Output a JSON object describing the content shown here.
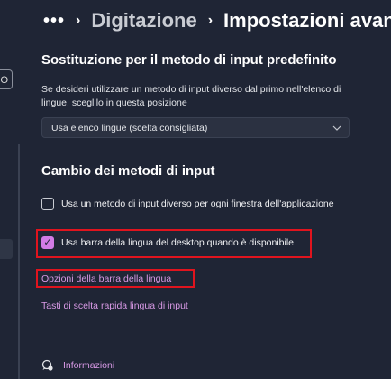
{
  "sidebar": {
    "search_fragment": "O"
  },
  "breadcrumb": {
    "more": "•••",
    "separator": "›",
    "parent": "Digitazione",
    "current": "Impostazioni avanzate"
  },
  "default_input": {
    "title": "Sostituzione per il metodo di input predefinito",
    "description": "Se desideri utilizzare un metodo di input diverso dal primo nell'elenco di lingue, sceglilo in questa posizione",
    "dropdown_value": "Usa elenco lingue (scelta consigliata)",
    "dropdown_icon": "chevron-down-icon"
  },
  "switching": {
    "title": "Cambio dei metodi di input",
    "checkbox_per_app": {
      "label": "Usa un metodo di input diverso per ogni finestra dell'applicazione",
      "checked": false
    },
    "checkbox_language_bar": {
      "label": "Usa barra della lingua del desktop quando è disponibile",
      "checked": true,
      "check_mark": "✓"
    },
    "link_language_bar_options": "Opzioni della barra della lingua",
    "link_hotkeys": "Tasti di scelta rapida lingua di input"
  },
  "footer": {
    "info_label": "Informazioni",
    "info_icon": "help-chat-icon"
  },
  "colors": {
    "background": "#1f2535",
    "accent": "#d27be6",
    "link": "#d99ae6",
    "highlight_box": "#e0141e"
  }
}
